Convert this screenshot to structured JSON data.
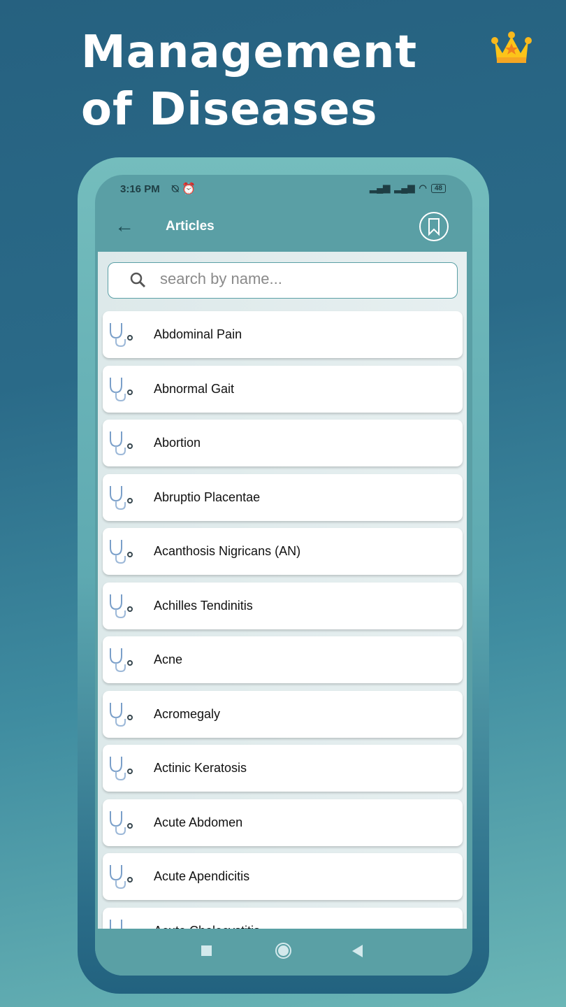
{
  "promo": {
    "headline_line1": "Management",
    "headline_line2": "of Diseases",
    "crown_icon": "crown-icon"
  },
  "status_bar": {
    "time": "3:16 PM",
    "battery": "48"
  },
  "app_bar": {
    "title": "Articles"
  },
  "search": {
    "placeholder": "search by name...",
    "value": ""
  },
  "articles": [
    {
      "label": "Abdominal Pain"
    },
    {
      "label": "Abnormal Gait"
    },
    {
      "label": "Abortion"
    },
    {
      "label": "Abruptio Placentae"
    },
    {
      "label": "Acanthosis Nigricans (AN)"
    },
    {
      "label": "Achilles Tendinitis"
    },
    {
      "label": "Acne"
    },
    {
      "label": "Acromegaly"
    },
    {
      "label": "Actinic Keratosis"
    },
    {
      "label": "Acute Abdomen"
    },
    {
      "label": "Acute Apendicitis"
    },
    {
      "label": "Acute Cholecystitis"
    }
  ],
  "colors": {
    "accent": "#5a9fa5",
    "background_top": "#266180",
    "background_bottom": "#6bb6b6"
  }
}
